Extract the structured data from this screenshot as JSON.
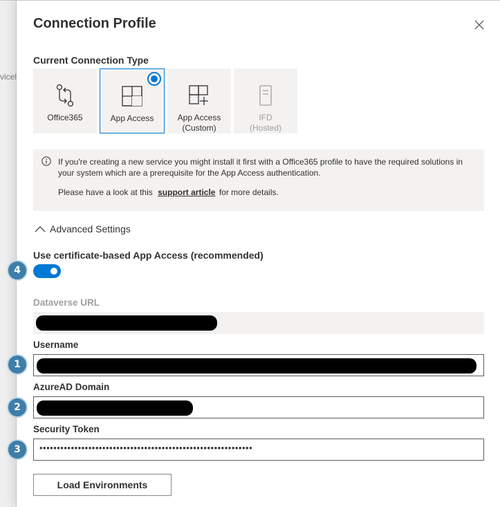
{
  "background": {
    "text": "vicel"
  },
  "dialog": {
    "title": "Connection Profile",
    "close_icon": "close-icon",
    "connection_type_label": "Current Connection Type",
    "tiles": [
      {
        "label": "Office365",
        "icon": "git-compare-icon",
        "selected": false,
        "disabled": false
      },
      {
        "label": "App Access",
        "icon": "app-grid-icon",
        "selected": true,
        "disabled": false
      },
      {
        "label": "App Access (Custom)",
        "icon": "app-grid-add-icon",
        "selected": false,
        "disabled": false
      },
      {
        "label": "IFD (Hosted)",
        "icon": "phone-icon",
        "selected": false,
        "disabled": true
      }
    ],
    "info": {
      "icon": "info-icon",
      "text1": "If you're creating a new service you might install it first with a Office365 profile to have the required solutions in your system which are a prerequisite for the App Access authentication.",
      "text2_prefix": "Please have a look at this",
      "link": "support article",
      "text2_suffix": "for more details."
    },
    "advanced_settings": {
      "label": "Advanced Settings",
      "icon": "chevron-up-icon",
      "expanded": true
    },
    "certificate": {
      "label": "Use certificate-based App Access (recommended)",
      "enabled": true
    },
    "fields": {
      "dataverse_url": {
        "label": "Dataverse URL",
        "value": "[redacted]"
      },
      "username": {
        "label": "Username",
        "value": "[redacted]"
      },
      "azuread_domain": {
        "label": "AzureAD Domain",
        "value": "[redacted]"
      },
      "security_token": {
        "label": "Security Token",
        "value": "•••••••••••••••••••••••••••••••••••••••••••••••••••••••••••••"
      }
    },
    "load_button": "Load Environments"
  },
  "badges": {
    "one": "1",
    "two": "2",
    "three": "3",
    "four": "4"
  },
  "colors": {
    "accent": "#0078d4",
    "badge": "#3e7ea8"
  }
}
